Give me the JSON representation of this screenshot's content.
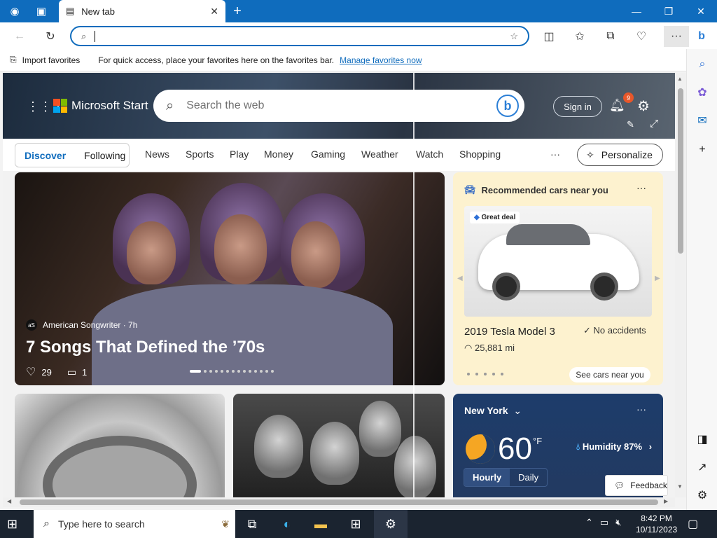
{
  "browser": {
    "tab_title": "New tab",
    "address_value": "",
    "favbar": {
      "import_label": "Import favorites",
      "message": "For quick access, place your favorites here on the favorites bar.",
      "manage_link": "Manage favorites now"
    }
  },
  "msstart": {
    "brand": "Microsoft Start",
    "search_placeholder": "Search the web",
    "signin_label": "Sign in",
    "notification_count": "9",
    "pills": [
      "Discover",
      "Following"
    ],
    "nav": [
      "News",
      "Sports",
      "Play",
      "Money",
      "Gaming",
      "Weather",
      "Watch",
      "Shopping"
    ],
    "nav_more": "···",
    "personalize_label": "Personalize"
  },
  "hero_story": {
    "source": "American Songwriter · 7h",
    "source_logo": "aS",
    "title": "7 Songs That Defined the ’70s",
    "likes": "29",
    "comments": "1"
  },
  "cars": {
    "header": "Recommended cars near you",
    "badge": "Great deal",
    "model": "2019 Tesla Model 3",
    "accidents": "No accidents",
    "mileage": "25,881 mi",
    "see_label": "See cars near you"
  },
  "weather": {
    "location": "New York",
    "temp": "60",
    "unit": "°F",
    "humidity": "Humidity 87%",
    "tabs": [
      "Hourly",
      "Daily"
    ]
  },
  "feedback_label": "Feedback",
  "taskbar": {
    "search_placeholder": "Type here to search",
    "time": "8:42 PM",
    "date": "10/11/2023"
  },
  "colors": {
    "accent": "#0f6cbd",
    "titlebar": "#0f6cbd",
    "taskbar": "#1b2430"
  }
}
